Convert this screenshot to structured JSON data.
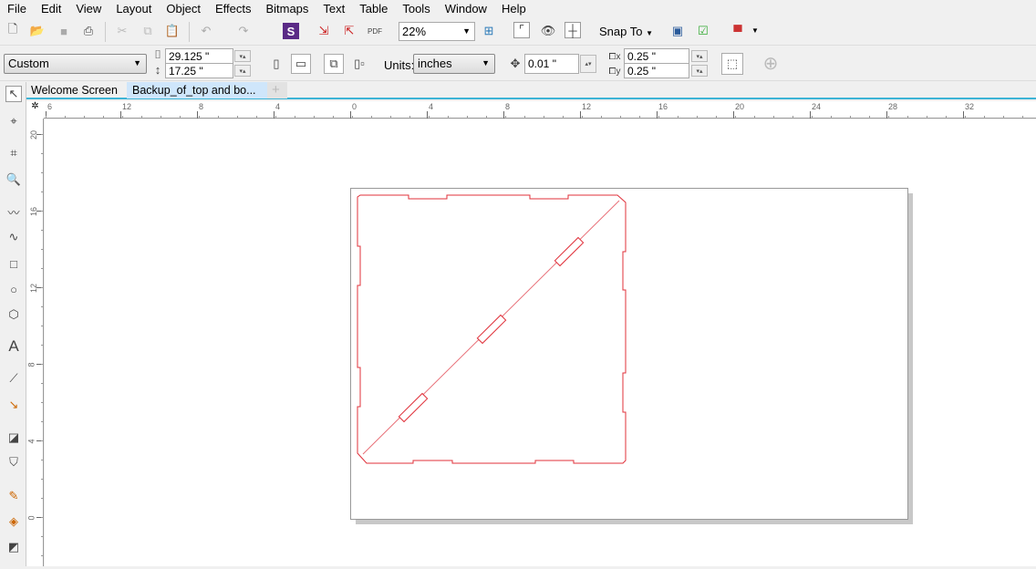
{
  "menu": [
    "File",
    "Edit",
    "View",
    "Layout",
    "Object",
    "Effects",
    "Bitmaps",
    "Text",
    "Table",
    "Tools",
    "Window",
    "Help"
  ],
  "toolbar": {
    "zoom": "22%",
    "snap_to": "Snap To",
    "icons": [
      "new-icon",
      "open-icon",
      "save-icon",
      "print-icon",
      "cut-icon",
      "copy-icon",
      "paste-icon",
      "undo-icon",
      "redo-icon",
      "app-launcher-icon",
      "import-icon",
      "export-icon",
      "publish-pdf-icon",
      "full-screen-icon",
      "rulers-icon",
      "grid-icon",
      "guidelines-icon",
      "welcome-screen-icon",
      "options-icon",
      "color-proof-icon"
    ]
  },
  "propertybar": {
    "page_preset": "Custom",
    "width": "29.125 \"",
    "height": "17.25 \"",
    "units_label": "Units:",
    "units": "inches",
    "nudge": "0.01 \"",
    "dup_x": "0.25 \"",
    "dup_y": "0.25 \""
  },
  "tabs": [
    "Welcome Screen",
    "Backup_of_top and bo..."
  ],
  "ruler": {
    "h_labels": [
      "6",
      "12",
      "8",
      "4",
      "0",
      "4",
      "8",
      "12",
      "16",
      "20",
      "24",
      "28",
      "32"
    ],
    "v_labels": [
      "20",
      "16",
      "12",
      "8",
      "4",
      "0"
    ]
  },
  "colors": {
    "outline": "#e0303a",
    "active_tab": "#cfe6fb",
    "tab_underline": "#3cb4d6"
  }
}
